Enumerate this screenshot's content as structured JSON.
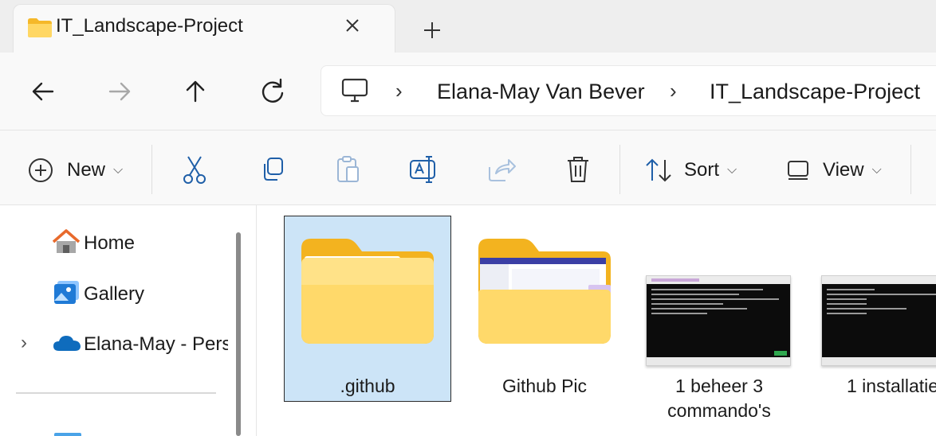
{
  "tab": {
    "title": "IT_Landscape-Project",
    "icon": "folder-icon",
    "close_icon": "close-icon",
    "new_tab_icon": "plus-icon"
  },
  "nav": {
    "back_icon": "arrow-left-icon",
    "forward_icon": "arrow-right-icon",
    "up_icon": "arrow-up-icon",
    "refresh_icon": "refresh-icon",
    "breadcrumb": [
      "Elana-May Van Bever",
      "IT_Landscape-Project"
    ],
    "root_icon": "monitor-icon"
  },
  "toolbar": {
    "new_label": "New",
    "sort_label": "Sort",
    "view_label": "View",
    "icons": [
      "plus-circle-icon",
      "cut-icon",
      "copy-icon",
      "paste-icon",
      "rename-icon",
      "share-icon",
      "delete-icon",
      "sort-icon",
      "view-icon"
    ]
  },
  "sidebar": {
    "items": [
      {
        "label": "Home",
        "icon": "home-icon"
      },
      {
        "label": "Gallery",
        "icon": "gallery-icon"
      },
      {
        "label": "Elana-May - Perso",
        "icon": "onedrive-cloud-icon"
      }
    ]
  },
  "items": [
    {
      "label": ".github",
      "type": "folder",
      "selected": true
    },
    {
      "label": "Github Pic",
      "type": "folder"
    },
    {
      "label": "1 beheer 3 commando's",
      "type": "file"
    },
    {
      "label": "1 installatie",
      "type": "file"
    }
  ],
  "colors": {
    "selection": "#cce4f7",
    "folder": "#f7c948",
    "accent": "#005fb8",
    "onedrive": "#0f6cbd"
  }
}
